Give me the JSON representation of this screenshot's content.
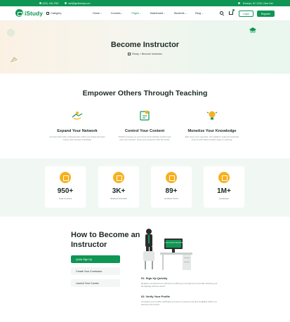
{
  "topbar": {
    "phone": "(000) -156-7960",
    "email": "mail@igniticstudy.com",
    "address": "Brooklyn, NY 11201, New York"
  },
  "header": {
    "logo_text": "iStudy",
    "category_label": "Category",
    "nav": [
      {
        "label": "Home",
        "active": false
      },
      {
        "label": "Courses",
        "active": false
      },
      {
        "label": "Pages",
        "active": true
      },
      {
        "label": "Dashboard",
        "active": false
      },
      {
        "label": "Students",
        "active": false
      },
      {
        "label": "Blog",
        "active": false
      }
    ],
    "login_label": "Login",
    "register_label": "Register"
  },
  "hero": {
    "title": "Become Instructor",
    "breadcrumb_home": "iStudy",
    "breadcrumb_sep": ">",
    "breadcrumb_current": "Become Instructor"
  },
  "features": {
    "section_title": "Empower Others Through Teaching",
    "items": [
      {
        "title": "Expand Your Network",
        "desc": "Connect with other professionals, build your brand and earn money with courses worldwide.",
        "icon": "handshake-icon"
      },
      {
        "title": "Control Your Content",
        "desc": "Publish courses on your terms and maintain control over your own content. Grow your presence with the world.",
        "icon": "content-icon"
      },
      {
        "title": "Monetize Your Knowledge",
        "desc": "Earn from your expertise. Our platform supports instructor income and helps creators keep on earning.",
        "icon": "lightbulb-icon"
      }
    ]
  },
  "stats": [
    {
      "value": "950+",
      "label": "Total Courses",
      "icon": "book-icon"
    },
    {
      "value": "3K+",
      "label": "Students Enrolled",
      "icon": "students-icon"
    },
    {
      "value": "89+",
      "label": "Certified Tutors",
      "icon": "tutor-icon"
    },
    {
      "value": "1M+",
      "label": "Graduates",
      "icon": "graduate-icon"
    }
  ],
  "how_to": {
    "title": "How to Become an Instructor",
    "steps": [
      {
        "label": "Quick Sign Up",
        "active": true
      },
      {
        "label": "Create Your Curriculum",
        "active": false
      },
      {
        "label": "Launch Your Course",
        "active": false
      }
    ],
    "details": [
      {
        "heading": "01. Sign Up Quickly",
        "desc": "Register yourself as an instructor by filling up a simple form and start sharing your knowledge with the world."
      },
      {
        "heading": "02. Verify Your Profile",
        "desc": "Complete your profile verification process to ensure trust and credibility within our learning community."
      }
    ],
    "monitor_text": "LEARN ONLINE ANYTIME ANYWHERE"
  },
  "colors": {
    "brand": "#109654",
    "accent": "#f6b11c"
  }
}
